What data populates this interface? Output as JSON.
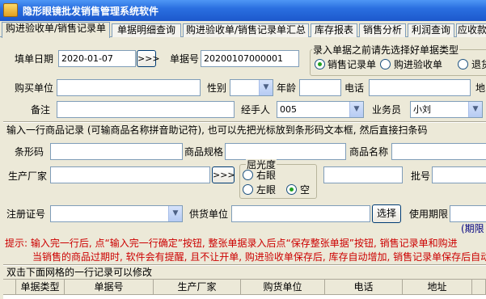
{
  "window": {
    "title": "隐形眼镜批发销售管理系统软件"
  },
  "tabs": [
    {
      "label": "购进验收单/销售记录单"
    },
    {
      "label": "单据明细查询"
    },
    {
      "label": "购进验收单/销售记录单汇总"
    },
    {
      "label": "库存报表"
    },
    {
      "label": "销售分析"
    },
    {
      "label": "利润查询"
    },
    {
      "label": "应收款"
    }
  ],
  "header_form": {
    "date_label": "填单日期",
    "date_value": "2020-01-07",
    "date_button": ">>>",
    "docno_label": "单据号",
    "docno_value": "20200107000001",
    "doctype_legend": "录入单据之前请先选择好单据类型",
    "doctype_options": [
      {
        "label": "销售记录单",
        "selected": true
      },
      {
        "label": "购进验收单",
        "selected": false
      },
      {
        "label": "退货",
        "selected": false
      }
    ],
    "buyer_label": "购买单位",
    "buyer_value": "",
    "gender_label": "性别",
    "gender_value": "",
    "age_label": "年龄",
    "age_value": "",
    "phone_label": "电话",
    "phone_value": "",
    "address_label": "地",
    "remark_label": "备注",
    "remark_value": "",
    "handler_label": "经手人",
    "handler_value": "005",
    "salesman_label": "业务员",
    "salesman_value": "小刘"
  },
  "item_section": {
    "heading": "输入一行商品记录 (可输商品名称拼音助记符), 也可以先把光标放到条形码文本框, 然后直接扫条码",
    "barcode_label": "条形码",
    "barcode_value": "",
    "spec_label": "商品规格",
    "spec_value": "",
    "name_label": "商品名称",
    "name_value": "",
    "maker_label": "生产厂家",
    "maker_value": "",
    "maker_button": ">>>",
    "diopter_legend": "屈光度",
    "diopter_options": [
      {
        "label": "右眼",
        "selected": false
      },
      {
        "label": "左眼",
        "selected": false
      },
      {
        "label": "空",
        "selected": true
      }
    ],
    "diopter_value": "",
    "batch_label": "批号",
    "batch_value": "",
    "regno_label": "注册证号",
    "regno_value": "",
    "supplier_label": "供货单位",
    "supplier_value": "",
    "select_button": "选择",
    "expiry_label": "使用期限",
    "expiry_value": "",
    "expiry_hint": "(期限"
  },
  "tips": {
    "line1": "提示: 输入完一行后, 点“输入完一行确定”按钮, 整张单据录入后点“保存整张单据”按钮, 销售记录单和购进",
    "line2": "当销售的商品过期时, 软件会有提醒, 且不让开单, 购进验收单保存后, 库存自动增加, 销售记录单保存后自动"
  },
  "grid": {
    "caption": "双击下面网格的一行记录可以修改",
    "columns": [
      "单据类型",
      "单据号",
      "生产厂家",
      "购货单位",
      "电话",
      "地址",
      ""
    ]
  },
  "colors": {
    "accent": "#1c58cc",
    "hint": "#cc0000",
    "radio_dot": "#21a121"
  }
}
